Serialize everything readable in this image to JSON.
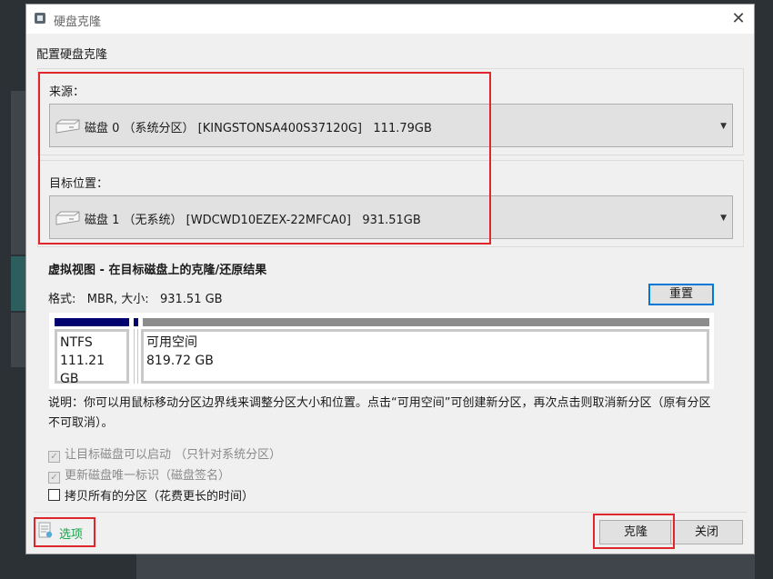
{
  "window": {
    "title": "硬盘克隆",
    "close_glyph": "✕"
  },
  "heading": "配置硬盘克隆",
  "source": {
    "label": "来源：",
    "disk_text": "磁盘 0 （系统分区） [KINGSTONSA400S37120G]   111.79GB"
  },
  "target": {
    "label": "目标位置：",
    "disk_text": "磁盘 1 （无系统） [WDCWD10EZEX-22MFCA0]   931.51GB"
  },
  "virtual_view": {
    "title": "虚拟视图 - 在目标磁盘上的克隆/还原结果",
    "format_info": "格式:   MBR, 大小:   931.51 GB",
    "reset_label": "重置",
    "partitions": [
      {
        "fs": "NTFS",
        "size": "111.21 GB",
        "bar_color": "#00006e"
      },
      {
        "fs": "可用空间",
        "size": "819.72 GB",
        "bar_color": "#8c8c8c"
      }
    ]
  },
  "note": "说明：你可以用鼠标移动分区边界线来调整分区大小和位置。点击“可用空间”可创建新分区，再次点击则取消新分区（原有分区不可取消）。",
  "options": [
    {
      "label": "让目标磁盘可以启动 （只针对系统分区）",
      "checked": true,
      "disabled": true
    },
    {
      "label": "更新磁盘唯一标识（磁盘签名）",
      "checked": true,
      "disabled": true
    },
    {
      "label": "拷贝所有的分区（花费更长的时间）",
      "checked": false,
      "disabled": false
    }
  ],
  "footer": {
    "options_label": "选项",
    "clone_label": "克隆",
    "close_label": "关闭"
  },
  "colors": {
    "highlight_red": "#e0262d",
    "accent_blue": "#0078d7",
    "options_green": "#16a34a"
  }
}
